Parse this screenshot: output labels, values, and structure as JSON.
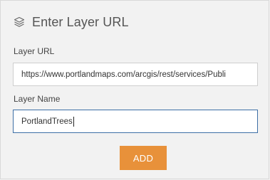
{
  "header": {
    "title": "Enter Layer URL",
    "icon": "layers-icon"
  },
  "form": {
    "url_label": "Layer URL",
    "url_value": "https://www.portlandmaps.com/arcgis/rest/services/Publi",
    "name_label": "Layer Name",
    "name_value": "PortlandTrees",
    "add_label": "ADD"
  },
  "colors": {
    "accent": "#e8913a",
    "focus_border": "#3d6fa6",
    "background": "#f2f2f2"
  }
}
